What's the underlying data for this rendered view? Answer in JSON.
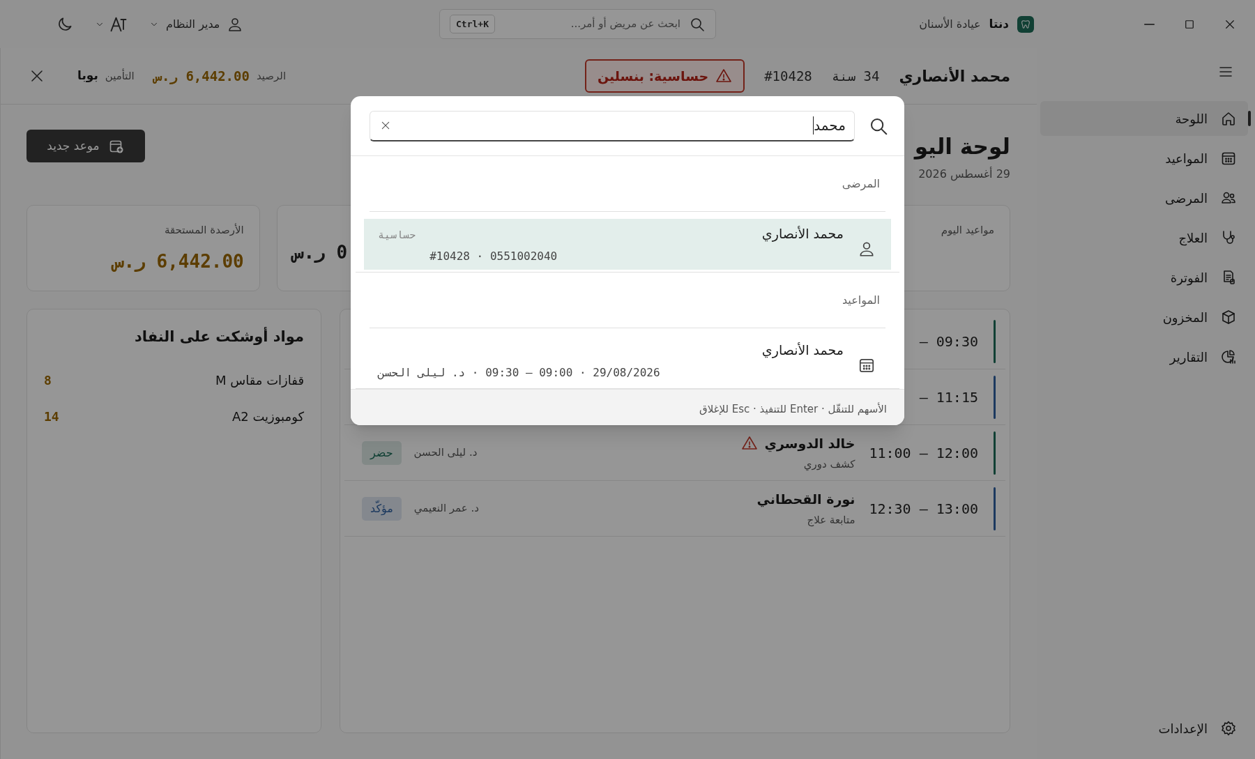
{
  "titlebar": {
    "brand": "دنتا",
    "subtitle": "عيادة الأسنان",
    "search": {
      "placeholder": "ابحث عن مريض أو أمر...",
      "shortcut": "Ctrl+K"
    },
    "user": "مدير النظام"
  },
  "sidebar": {
    "items": [
      {
        "label": "اللوحة",
        "selected": true
      },
      {
        "label": "المواعيد",
        "selected": false
      },
      {
        "label": "المرضى",
        "selected": false
      },
      {
        "label": "العلاج",
        "selected": false
      },
      {
        "label": "الفوترة",
        "selected": false
      },
      {
        "label": "المخزون",
        "selected": false
      },
      {
        "label": "التقارير",
        "selected": false
      }
    ],
    "footer": {
      "label": "الإعدادات",
      "selected": false
    }
  },
  "patient_bar": {
    "name": "محمد الأنصاري",
    "age": "34 سنة",
    "file_no": "#10428",
    "allergy": "حساسية: بنسلين",
    "balance_label": "الرصيد",
    "balance": "6,442.00 ر.س",
    "insurance_label": "التأمين",
    "insurance": "بوبا"
  },
  "page": {
    "title": "لوحة اليو",
    "date": "29 أغسطس 2026",
    "new_button": "موعد جديد"
  },
  "stats": [
    {
      "label": "مواعيد اليوم"
    },
    {
      "value": "0 ر.س"
    },
    {
      "label": "الأرصدة المستحقة",
      "value": "6,442.00 ر.س"
    }
  ],
  "appointments": {
    "rows": [
      {
        "time": "– 09:30",
        "color": "#114034"
      },
      {
        "time": "– 11:15",
        "color": "#1c395f"
      },
      {
        "time": "11:00 – 12:00",
        "name": "خالد الدوسري",
        "alert": true,
        "type": "كشف دوري",
        "doctor": "د. ليلى الحسن",
        "status": "حضر",
        "color": "#114034"
      },
      {
        "time": "12:30 – 13:00",
        "name": "نورة القحطاني",
        "alert": false,
        "type": "متابعة علاج",
        "doctor": "د. عمر النعيمي",
        "status": "مؤكّد",
        "color": "#1c395f"
      }
    ]
  },
  "low_stock": {
    "title": "مواد أوشكت على النفاد",
    "items": [
      {
        "name": "قفازات مقاس M",
        "qty": "8"
      },
      {
        "name": "كومبوزيت A2",
        "qty": "14"
      }
    ]
  },
  "command_palette": {
    "query": "محمد",
    "groups": [
      {
        "title": "المرضى",
        "results": [
          {
            "kind": "patient",
            "title": "محمد الأنصاري",
            "detail": "0551002040 · #10428",
            "tag": "حساسية",
            "selected": true
          }
        ]
      },
      {
        "title": "المواعيد",
        "results": [
          {
            "kind": "appointment",
            "title": "محمد الأنصاري",
            "detail": "29/08/2026 · 09:00 – 09:30 · د. ليلى الحسن",
            "selected": false
          }
        ]
      }
    ],
    "hint": "الأسهم للتنقّل · Enter للتنفيذ · Esc للإغلاق"
  }
}
